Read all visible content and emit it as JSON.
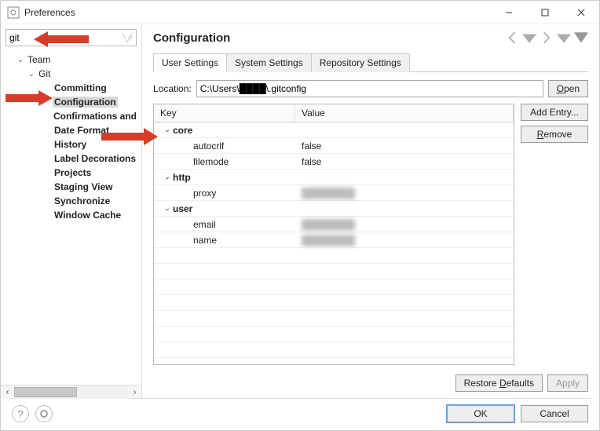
{
  "window": {
    "title": "Preferences"
  },
  "search": {
    "value": "git"
  },
  "tree": {
    "team": "Team",
    "git": "Git",
    "items": [
      "Committing",
      "Configuration",
      "Confirmations and",
      "Date Format",
      "History",
      "Label Decorations",
      "Projects",
      "Staging View",
      "Synchronize",
      "Window Cache"
    ]
  },
  "panel": {
    "heading": "Configuration"
  },
  "tabs": {
    "user": "User Settings",
    "system": "System Settings",
    "repo": "Repository Settings"
  },
  "location": {
    "label": "Location:",
    "value": "C:\\Users\\████\\.gitconfig",
    "open": "Open"
  },
  "table": {
    "headers": {
      "key": "Key",
      "value": "Value"
    },
    "rows": [
      {
        "type": "section",
        "key": "core"
      },
      {
        "type": "kv",
        "key": "autocrlf",
        "value": "false"
      },
      {
        "type": "kv",
        "key": "filemode",
        "value": "false"
      },
      {
        "type": "section",
        "key": "http"
      },
      {
        "type": "kv",
        "key": "proxy",
        "value": "",
        "blurred": true
      },
      {
        "type": "section",
        "key": "user"
      },
      {
        "type": "kv",
        "key": "email",
        "value": "",
        "blurred": true
      },
      {
        "type": "kv",
        "key": "name",
        "value": "",
        "blurred": true
      }
    ]
  },
  "sidebuttons": {
    "add": "Add Entry...",
    "remove": "Remove"
  },
  "restorerow": {
    "defaults": "Restore Defaults",
    "apply": "Apply"
  },
  "footer": {
    "ok": "OK",
    "cancel": "Cancel"
  }
}
